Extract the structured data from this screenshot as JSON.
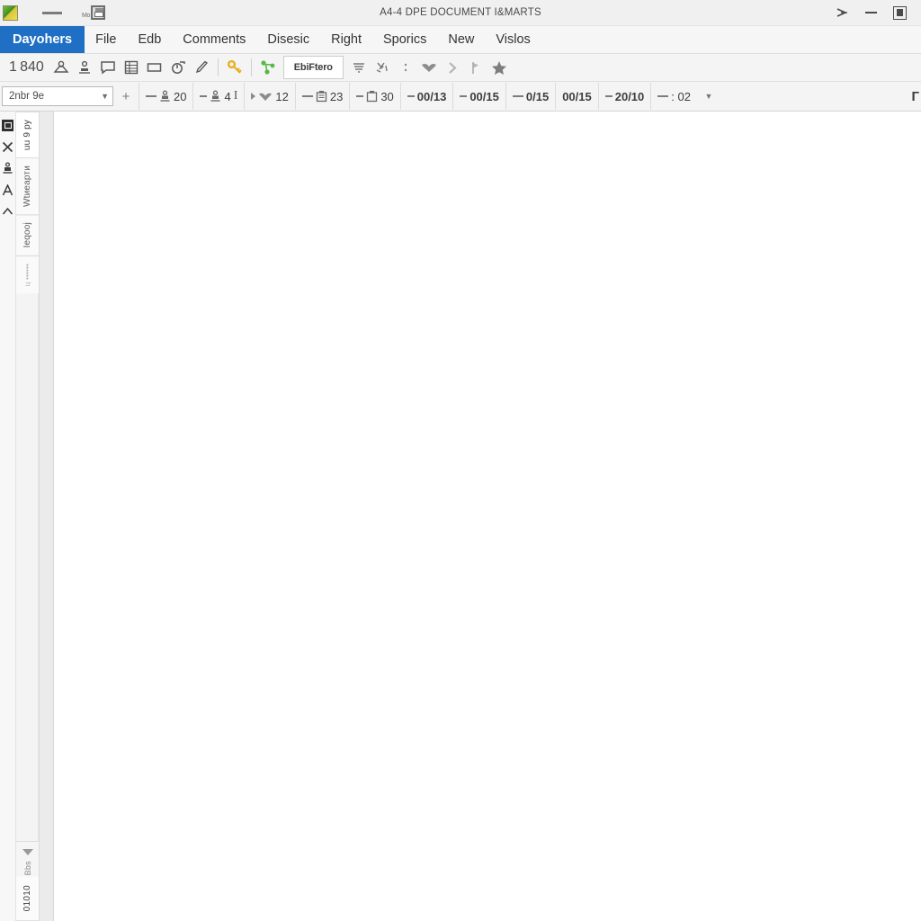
{
  "window": {
    "title": "A4-4 DPE DOCUMENT I&MARTS",
    "app_icon": "app-logo-icon",
    "quick_access": {
      "dash_icon": "dash-icon",
      "save_icon": "save-floppy-icon",
      "save_mini_label": "Mo"
    },
    "controls": {
      "pointer_label": "➢",
      "minimize_label": "minimize-icon",
      "restore_label": "restore-icon"
    }
  },
  "menubar": {
    "items": [
      {
        "label": "Dayohers",
        "active": true
      },
      {
        "label": "File",
        "active": false
      },
      {
        "label": "Edb",
        "active": false
      },
      {
        "label": "Comments",
        "active": false
      },
      {
        "label": "Disesic",
        "active": false
      },
      {
        "label": "Right",
        "active": false
      },
      {
        "label": "Sporics",
        "active": false
      },
      {
        "label": "New",
        "active": false
      },
      {
        "label": "Vislos",
        "active": false
      }
    ]
  },
  "toolbar": {
    "lead_number": "1 840",
    "icons_left": [
      "bowtie-person-icon",
      "stamp-icon",
      "speech-bubble-icon",
      "table-grid-icon",
      "rectangle-icon",
      "clock-arrow-icon",
      "pen-icon"
    ],
    "key_icon": "key-icon",
    "key_color": "#e8b023",
    "link_icon": "link-nodes-icon",
    "link_color": "#58b947",
    "button_label": "EbiFtero",
    "icons_right": [
      "align-lines-icon",
      "scatter-icon",
      "colon-icon",
      "bird-icon",
      "chevron-right-icon",
      "flag-icon",
      "star-icon"
    ]
  },
  "toolbar2": {
    "combo_value": "2nbr 9e",
    "combo_arrow": "chevron-down-icon",
    "plus_label": "+",
    "fields": [
      {
        "icon": "stamp-small-icon",
        "value": "20",
        "bold": false,
        "dash": "m"
      },
      {
        "icon": "stamp-small-icon",
        "value": "4",
        "bold": false,
        "dash": "s",
        "suffix": "I"
      },
      {
        "icon": "bird-small-icon",
        "value": "12",
        "bold": false,
        "dash": "caret"
      },
      {
        "icon": "clipboard-icon",
        "value": "23",
        "bold": false,
        "dash": "m"
      },
      {
        "icon": "clipboard-icon",
        "value": "30",
        "bold": false,
        "dash": "s"
      },
      {
        "icon": "",
        "value": "00/13",
        "bold": true,
        "dash": "s"
      },
      {
        "icon": "",
        "value": "00/15",
        "bold": true,
        "dash": "s"
      },
      {
        "icon": "",
        "value": "0/15",
        "bold": true,
        "dash": "m"
      },
      {
        "icon": "",
        "value": "00/15",
        "bold": true,
        "dash": "none"
      },
      {
        "icon": "",
        "value": "20/10",
        "bold": true,
        "dash": "s"
      },
      {
        "icon": "",
        "value": ": 02",
        "bold": false,
        "dash": "m"
      }
    ],
    "end_arrow": "chevron-down-icon",
    "end_glyph": "Г"
  },
  "sidebar": {
    "rail_icons": [
      "page-thumbnail-icon",
      "close-x-icon",
      "stamp-tool-icon",
      "text-a-icon",
      "chevron-up-icon"
    ],
    "tabs": [
      {
        "label": "uu 9 ру",
        "selected": true,
        "faint": false
      },
      {
        "label": "Wtиeaрти",
        "selected": false,
        "faint": false
      },
      {
        "label": "Іeqooј",
        "selected": false,
        "faint": false
      },
      {
        "label": "ц ••••••",
        "selected": false,
        "faint": true
      }
    ],
    "bottom": {
      "caret_icon": "caret-down-icon",
      "label": "Bbs"
    },
    "footer_label": "01010"
  }
}
